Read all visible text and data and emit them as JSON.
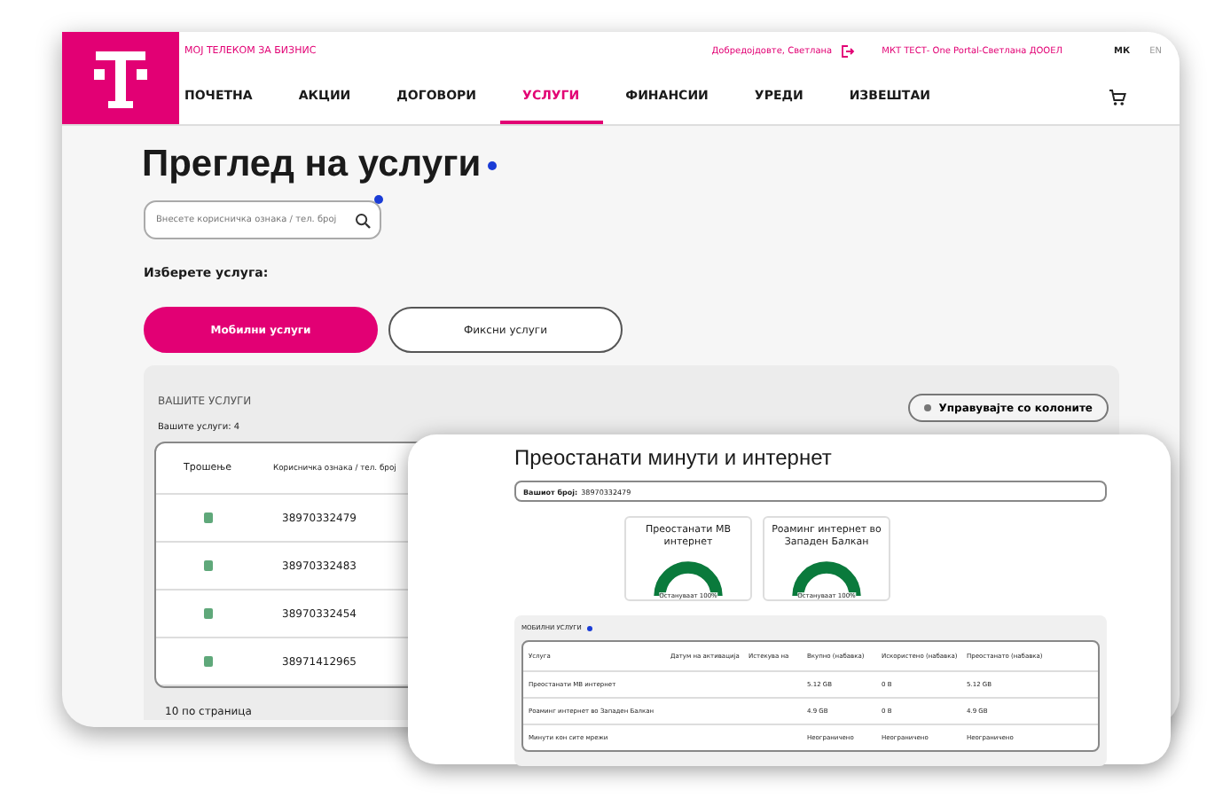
{
  "header": {
    "brand": "МОЈ ТЕЛЕКОМ ЗА БИЗНИС",
    "greeting": "Добредојдовте, Светлана",
    "company": "МКТ ТЕСТ- One Portal-Светлана ДООЕЛ",
    "languages": [
      {
        "label": "МК",
        "selected": true
      },
      {
        "label": "EN",
        "selected": false
      }
    ],
    "nav": [
      {
        "label": "ПОЧЕТНА",
        "selected": false
      },
      {
        "label": "АКЦИИ",
        "selected": false
      },
      {
        "label": "ДОГОВОРИ",
        "selected": false
      },
      {
        "label": "УСЛУГИ",
        "selected": true
      },
      {
        "label": "ФИНАНСИИ",
        "selected": false
      },
      {
        "label": "УРЕДИ",
        "selected": false
      },
      {
        "label": "ИЗВЕШТАИ",
        "selected": false
      }
    ]
  },
  "page": {
    "title": "Преглед на услуги",
    "search": {
      "placeholder": "Внесете корисничка ознака / тел. број"
    },
    "choose_label": "Изберете услуга:",
    "service_types": [
      {
        "label": "Мобилни услуги",
        "selected": true
      },
      {
        "label": "Фиксни услуги",
        "selected": false
      }
    ]
  },
  "services": {
    "title": "ВАШИТЕ УСЛУГИ",
    "manage_button": "Управувајте со колоните",
    "count": "Вашите услуги: 4",
    "columns": [
      "Трошење",
      "Корисничка ознака / тел. број"
    ],
    "rows": [
      {
        "number": "38970332479"
      },
      {
        "number": "38970332483"
      },
      {
        "number": "38970332454"
      },
      {
        "number": "38971412965"
      }
    ],
    "page_size": "10 по страница"
  },
  "detail": {
    "title": "Преостанати минути и интернет",
    "number_label": "Вашиот број:",
    "number": "38970332479",
    "gauges": [
      {
        "title": "Преостанати MB интернет",
        "level": 1,
        "caption": "Остануваат 100%"
      },
      {
        "title": "Роаминг интернет во Западен Балкан",
        "level": 1,
        "caption": "Остануваат 100%"
      }
    ],
    "table_title": "МОБИЛНИ УСЛУГИ",
    "columns": [
      "Услуга",
      "Датум на активација",
      "Истекува на",
      "Вкупно (набавка)",
      "Искористено (набавка)",
      "Преостанато (набавка)"
    ],
    "rows": [
      [
        "Преостанати MB интернет",
        "",
        "",
        "5.12 GB",
        "0 B",
        "5.12 GB"
      ],
      [
        "Роаминг интернет во Западен Балкан",
        "",
        "",
        "4.9 GB",
        "0 B",
        "4.9 GB"
      ],
      [
        "Минути кон сите мрежи",
        "",
        "",
        "Неограничено",
        "Неограничено",
        "Неограничено"
      ]
    ]
  }
}
